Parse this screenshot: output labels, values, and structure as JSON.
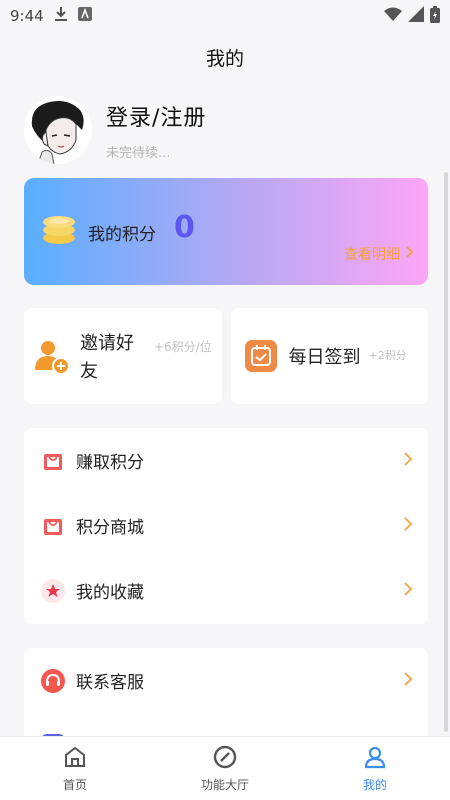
{
  "status_bar": {
    "time": "9:44"
  },
  "header": {
    "title": "我的"
  },
  "profile": {
    "name": "登录/注册",
    "subtitle": "未完待续..."
  },
  "points": {
    "label": "我的积分",
    "value": "0",
    "detail_label": "查看明细"
  },
  "tasks": {
    "invite": {
      "label": "邀请好友",
      "bonus": "+6积分/位"
    },
    "daily": {
      "label": "每日签到",
      "bonus": "+2积分"
    }
  },
  "menu": {
    "group1": [
      {
        "label": "赚取积分",
        "icon": "bag-icon"
      },
      {
        "label": "积分商城",
        "icon": "bag-icon"
      },
      {
        "label": "我的收藏",
        "icon": "star-icon"
      }
    ],
    "group2": [
      {
        "label": "联系客服",
        "icon": "service-icon"
      }
    ]
  },
  "tabbar": {
    "home": "首页",
    "functions": "功能大厅",
    "mine": "我的"
  },
  "colors": {
    "accent": "#3b8df0",
    "orange": "#f2a23a",
    "points_value": "#5b57f0"
  }
}
